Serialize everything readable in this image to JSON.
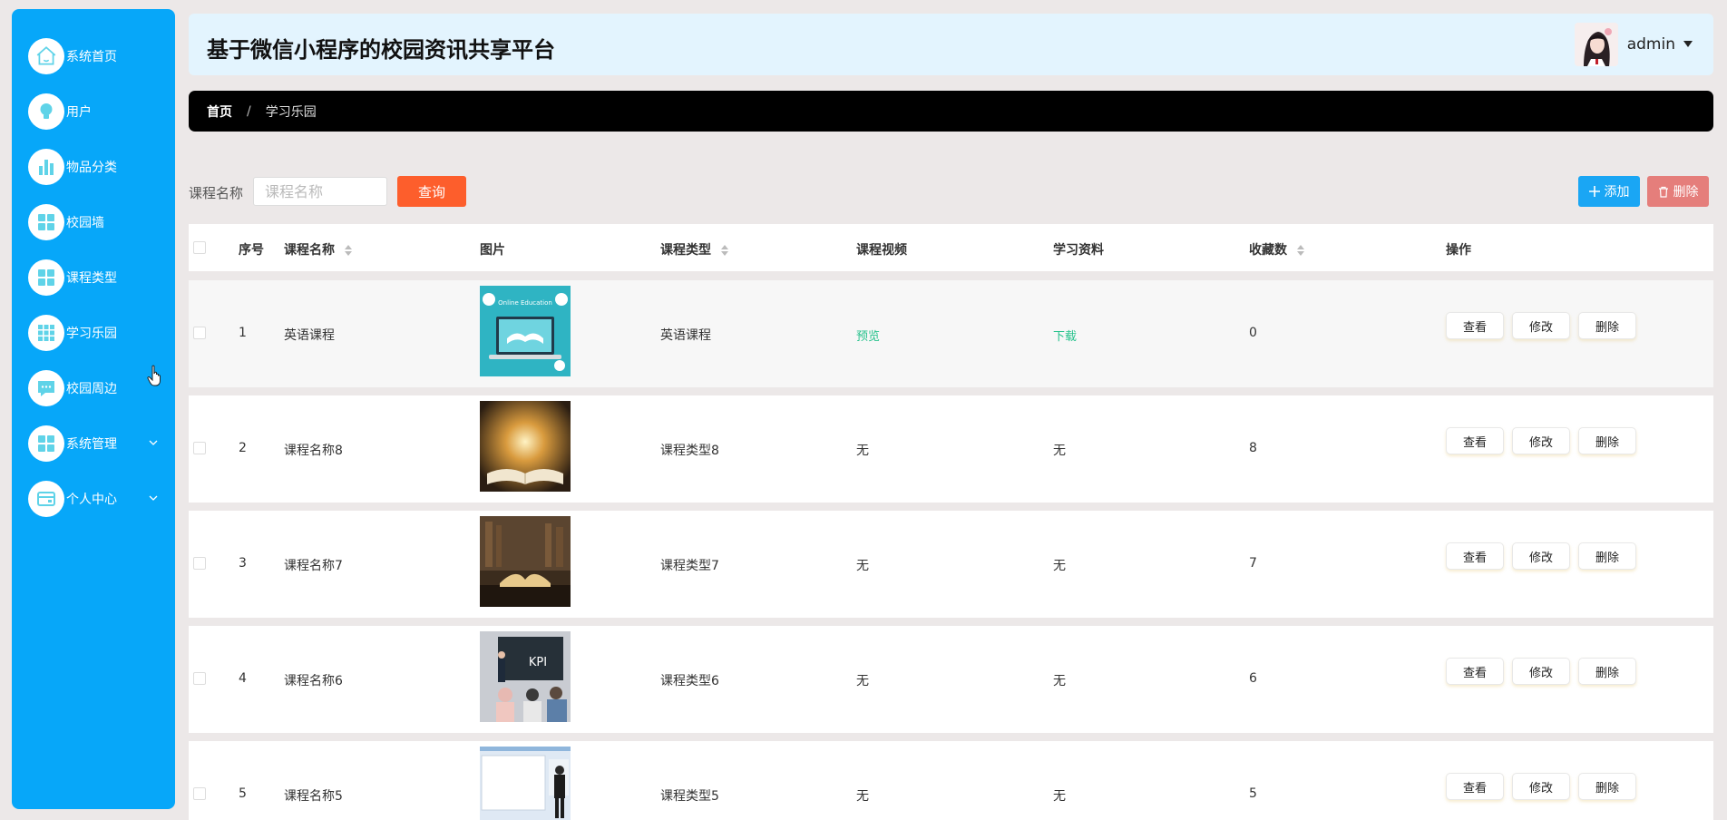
{
  "sidebar": {
    "items": [
      {
        "label": "系统首页",
        "icon": "home-icon"
      },
      {
        "label": "用户",
        "icon": "bulb-icon"
      },
      {
        "label": "物品分类",
        "icon": "bar-chart-icon"
      },
      {
        "label": "校园墙",
        "icon": "grid-icon"
      },
      {
        "label": "课程类型",
        "icon": "grid-icon"
      },
      {
        "label": "学习乐园",
        "icon": "apps-icon"
      },
      {
        "label": "校园周边",
        "icon": "chat-icon"
      },
      {
        "label": "系统管理",
        "icon": "grid-icon",
        "expandable": true
      },
      {
        "label": "个人中心",
        "icon": "card-icon",
        "expandable": true
      }
    ]
  },
  "header": {
    "title": "基于微信小程序的校园资讯共享平台",
    "username": "admin"
  },
  "breadcrumb": {
    "home": "首页",
    "separator": "/",
    "current": "学习乐园"
  },
  "search": {
    "label": "课程名称",
    "placeholder": "课程名称",
    "value": "",
    "query_label": "查询"
  },
  "toolbar": {
    "add_label": "添加",
    "delete_label": "删除"
  },
  "table": {
    "columns": {
      "index": "序号",
      "name": "课程名称",
      "image": "图片",
      "type": "课程类型",
      "video": "课程视频",
      "material": "学习资料",
      "favorites": "收藏数",
      "actions": "操作"
    },
    "action_labels": {
      "view": "查看",
      "edit": "修改",
      "delete": "删除"
    },
    "rows": [
      {
        "index": "1",
        "name": "英语课程",
        "image": "online-education",
        "type": "英语课程",
        "video": "预览",
        "material": "下载",
        "favorites": "0"
      },
      {
        "index": "2",
        "name": "课程名称8",
        "image": "glowing-book",
        "type": "课程类型8",
        "video": "无",
        "material": "无",
        "favorites": "8"
      },
      {
        "index": "3",
        "name": "课程名称7",
        "image": "library-book",
        "type": "课程类型7",
        "video": "无",
        "material": "无",
        "favorites": "7"
      },
      {
        "index": "4",
        "name": "课程名称6",
        "image": "kpi-classroom",
        "type": "课程类型6",
        "video": "无",
        "material": "无",
        "favorites": "6"
      },
      {
        "index": "5",
        "name": "课程名称5",
        "image": "presentation",
        "type": "课程类型5",
        "video": "无",
        "material": "无",
        "favorites": "5"
      }
    ]
  },
  "thumb_labels": {
    "online": "Online Education",
    "kpi": "KPI"
  },
  "colors": {
    "sidebar": "#07a7f9",
    "query": "#fd5e2c",
    "add": "#1aa6f4",
    "delete": "#e57e7b",
    "link": "#26c28c"
  }
}
